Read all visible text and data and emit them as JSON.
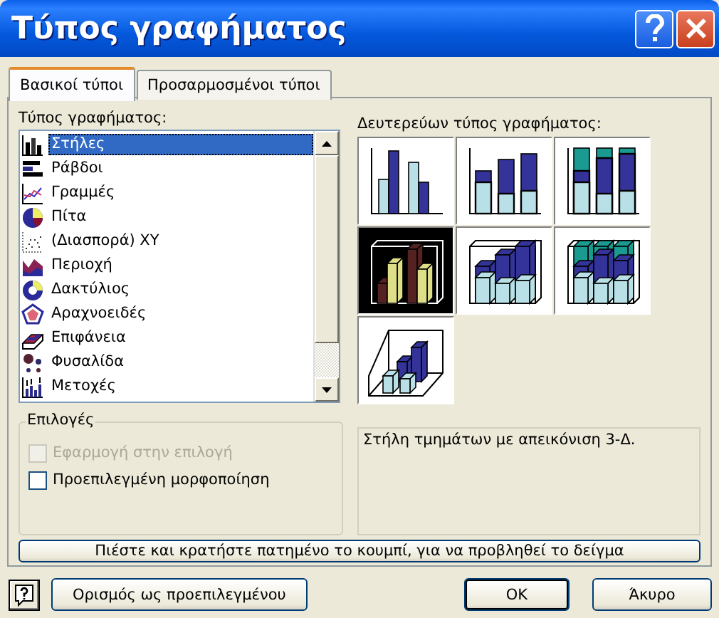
{
  "window": {
    "title": "Τύπος γραφήματος"
  },
  "tabs": [
    {
      "label": "Βασικοί τύποι",
      "selected": true
    },
    {
      "label": "Προσαρμοσμένοι τύποι",
      "selected": false
    }
  ],
  "chart_type": {
    "label": "Τύπος γραφήματος:",
    "items": [
      {
        "label": "Στήλες",
        "kind": "column",
        "selected": true
      },
      {
        "label": "Ράβδοι",
        "kind": "bar",
        "selected": false
      },
      {
        "label": "Γραμμές",
        "kind": "line",
        "selected": false
      },
      {
        "label": "Πίτα",
        "kind": "pie",
        "selected": false
      },
      {
        "label": "(Διασπορά) XY",
        "kind": "scatter",
        "selected": false
      },
      {
        "label": "Περιοχή",
        "kind": "area",
        "selected": false
      },
      {
        "label": "Δακτύλιος",
        "kind": "doughnut",
        "selected": false
      },
      {
        "label": "Αραχνοειδές",
        "kind": "radar",
        "selected": false
      },
      {
        "label": "Επιφάνεια",
        "kind": "surface",
        "selected": false
      },
      {
        "label": "Φυσαλίδα",
        "kind": "bubble",
        "selected": false
      },
      {
        "label": "Μετοχές",
        "kind": "stock",
        "selected": false
      }
    ]
  },
  "subtype": {
    "label": "Δευτερεύων τύπος γραφήματος:",
    "items": [
      {
        "kind": "clustered",
        "selected": false
      },
      {
        "kind": "stacked",
        "selected": false
      },
      {
        "kind": "percent",
        "selected": false
      },
      {
        "kind": "clustered3d",
        "selected": true
      },
      {
        "kind": "stacked3d",
        "selected": false
      },
      {
        "kind": "percent3d",
        "selected": false
      },
      {
        "kind": "column3d",
        "selected": false
      }
    ]
  },
  "options": {
    "title": "Επιλογές",
    "checkboxes": [
      {
        "label": "Εφαρμογή στην επιλογή",
        "checked": false,
        "disabled": true
      },
      {
        "label": "Προεπιλεγμένη μορφοποίηση",
        "checked": false,
        "disabled": false
      }
    ]
  },
  "description": "Στήλη τμημάτων με απεικόνιση 3-Δ.",
  "preview_button": "Πιέστε και κρατήστε πατημένο το κουμπί, για να προβληθεί το δείγμα",
  "footer": {
    "default_button": "Ορισμός ως προεπιλεγμένου",
    "ok": "OK",
    "cancel": "Άκυρο"
  }
}
